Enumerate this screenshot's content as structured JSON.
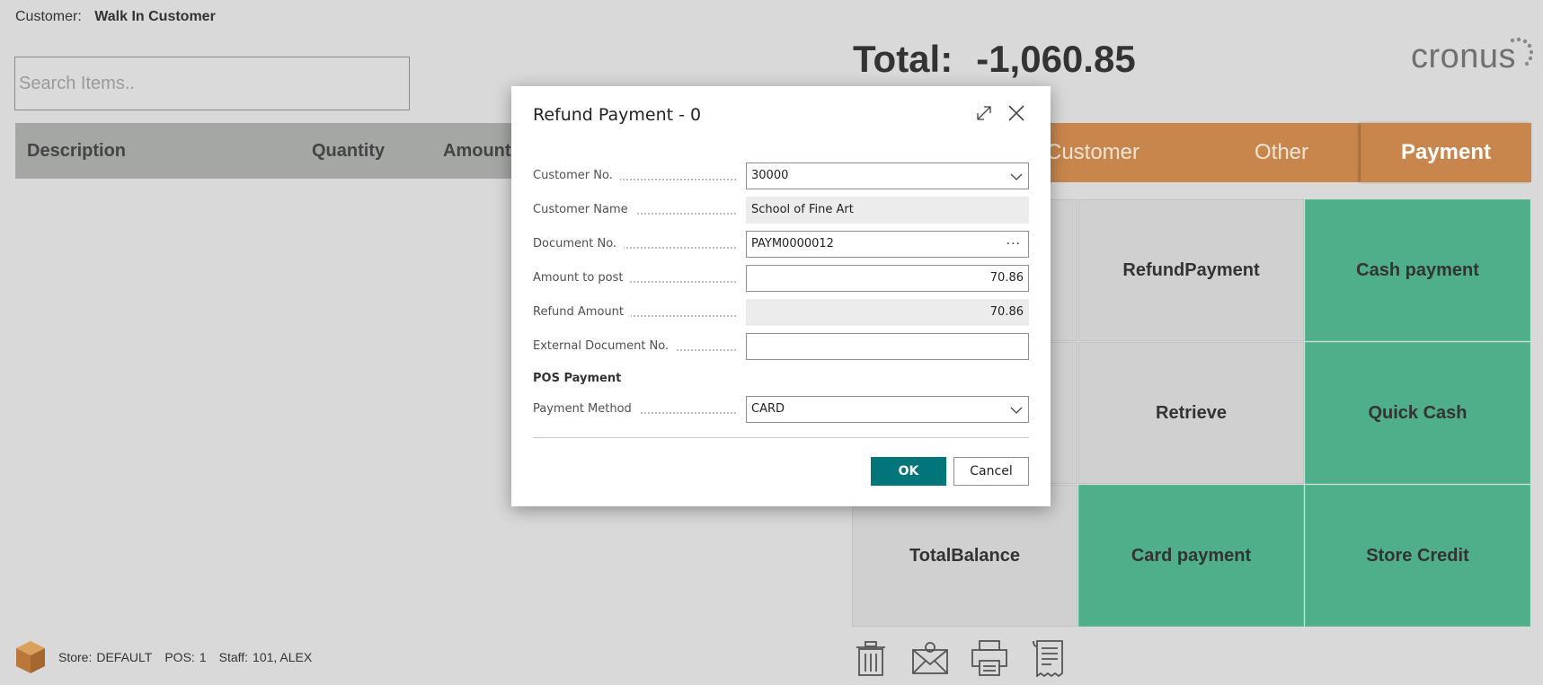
{
  "customer": {
    "label": "Customer:",
    "name": "Walk In Customer"
  },
  "search": {
    "placeholder": "Search Items.."
  },
  "grid": {
    "columns": [
      "Description",
      "Quantity",
      "Amount"
    ]
  },
  "total": {
    "label": "Total:",
    "value": "-1,060.85"
  },
  "logo": {
    "text": "cronus"
  },
  "tabs": [
    {
      "label": "Customer"
    },
    {
      "label": "Other"
    },
    {
      "label": "Payment",
      "active": true
    }
  ],
  "tiles": [
    {
      "label": "",
      "color": "grey"
    },
    {
      "label": "RefundPayment",
      "color": "grey"
    },
    {
      "label": "Cash payment",
      "color": "green"
    },
    {
      "label": "",
      "color": "grey"
    },
    {
      "label": "Retrieve",
      "color": "grey"
    },
    {
      "label": "Quick Cash",
      "color": "green"
    },
    {
      "label": "TotalBalance",
      "color": "grey"
    },
    {
      "label": "Card payment",
      "color": "green"
    },
    {
      "label": "Store Credit",
      "color": "green"
    }
  ],
  "footer": {
    "store_label": "Store:",
    "store_value": "DEFAULT",
    "pos_label": "POS:",
    "pos_value": "1",
    "staff_label": "Staff:",
    "staff_value": "101, ALEX",
    "icons": [
      "trash-icon",
      "email-icon",
      "printer-icon",
      "receipt-icon"
    ]
  },
  "dialog": {
    "title": "Refund Payment - 0",
    "fields": {
      "customer_no": {
        "label": "Customer No.",
        "value": "30000"
      },
      "customer_name": {
        "label": "Customer Name",
        "value": "School of Fine Art"
      },
      "document_no": {
        "label": "Document No.",
        "value": "PAYM0000012"
      },
      "amount_to_post": {
        "label": "Amount to post",
        "value": "70.86"
      },
      "refund_amount": {
        "label": "Refund Amount",
        "value": "70.86"
      },
      "external_document_no": {
        "label": "External Document No.",
        "value": ""
      },
      "payment_method": {
        "label": "Payment Method",
        "value": "CARD"
      }
    },
    "section": "POS Payment",
    "ellipsis": "···",
    "ok_label": "OK",
    "cancel_label": "Cancel"
  },
  "colors": {
    "background": "#d9d9d9",
    "tab_bar": "#c8864d",
    "tile_green": "#4faf8a",
    "tile_grey": "#d0d0d0",
    "primary_button": "#00767a"
  }
}
